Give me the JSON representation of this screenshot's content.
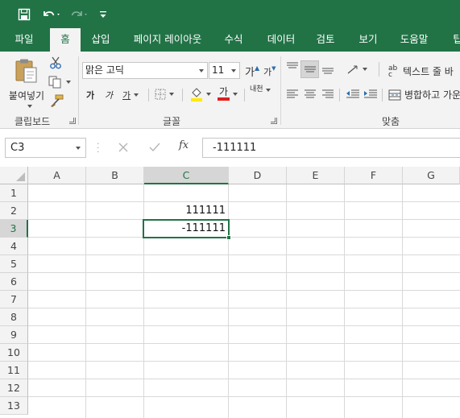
{
  "colors": {
    "brand": "#217346",
    "ribbon_bg": "#f3f3f3",
    "underline_red": "#e0201b",
    "highlight_yellow": "#ffea00"
  },
  "quick_access": {
    "save_icon": "save-icon",
    "undo_icon": "undo-icon",
    "redo_icon": "redo-icon",
    "customize_icon": "customize-qat-icon"
  },
  "tabs": [
    "파일",
    "홈",
    "삽입",
    "페이지 레이아웃",
    "수식",
    "데이터",
    "검토",
    "보기",
    "도움말",
    "팁"
  ],
  "active_tab": "홈",
  "ribbon": {
    "clipboard": {
      "paste_label": "붙여넣기",
      "group_label": "클립보드"
    },
    "font": {
      "font_name": "맑은 고딕",
      "font_size": "11",
      "grow_label": "가",
      "shrink_label": "가",
      "bold_label": "가",
      "italic_label": "가",
      "underline_label": "가",
      "font_color_label": "가",
      "phonetic_label": "내천",
      "group_label": "글꼴"
    },
    "alignment": {
      "wrap_text_label": "텍스트 줄 바",
      "merge_label": "병합하고 가운",
      "group_label": "맞춤"
    }
  },
  "formula_bar": {
    "name_box": "C3",
    "cancel_icon": "cancel-icon",
    "enter_icon": "enter-icon",
    "fx_label": "fx",
    "formula": "-111111"
  },
  "sheet": {
    "columns": [
      "A",
      "B",
      "C",
      "D",
      "E",
      "F",
      "G"
    ],
    "rows": [
      "1",
      "2",
      "3",
      "4",
      "5",
      "6",
      "7",
      "8",
      "9",
      "10",
      "11",
      "12",
      "13"
    ],
    "selected_column": "C",
    "selected_row": "3",
    "cells": {
      "C2": "111111",
      "C3": "-111111"
    }
  }
}
